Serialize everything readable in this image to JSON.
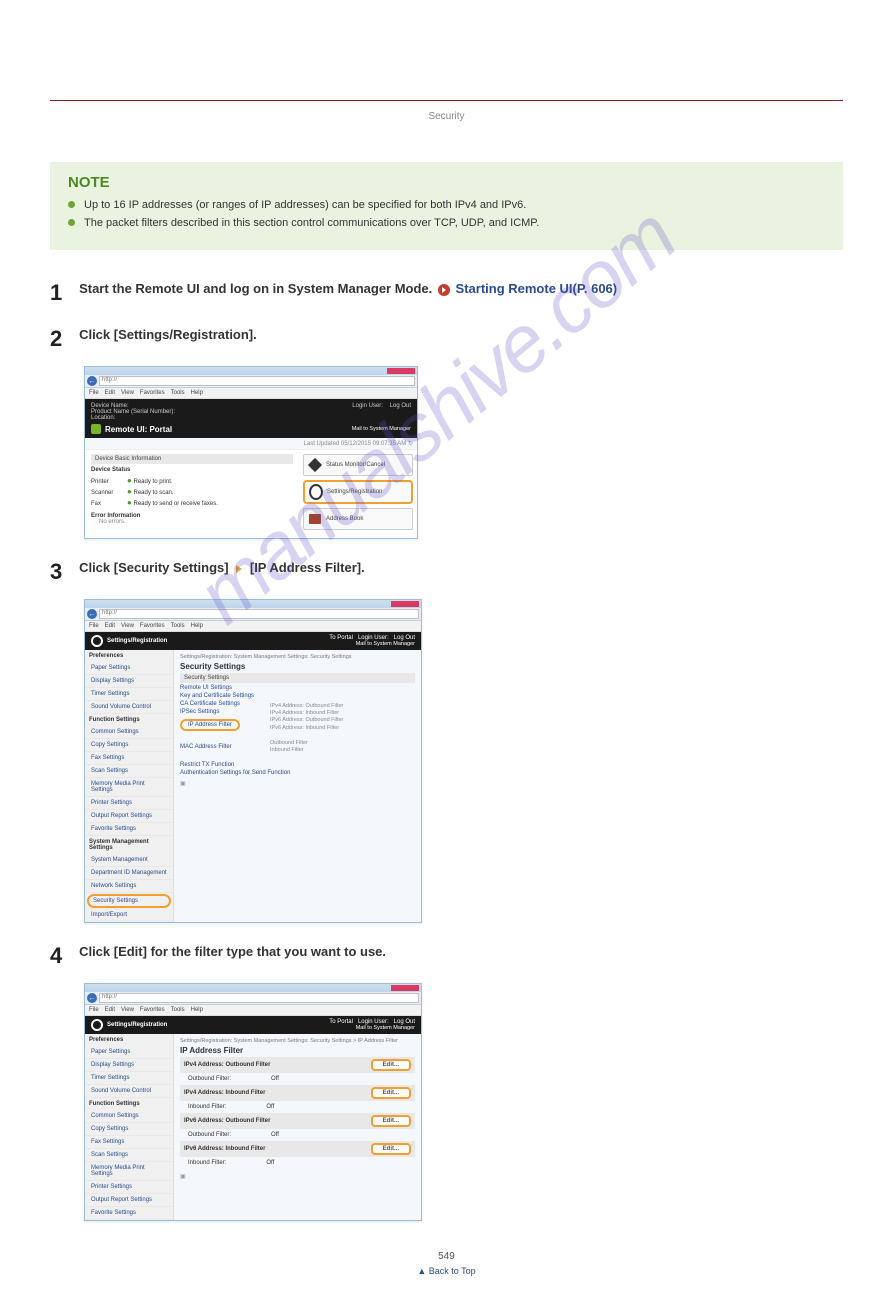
{
  "header": {
    "security_label": "Security"
  },
  "note": {
    "title": "NOTE",
    "items": [
      "Up to 16 IP addresses (or ranges of IP addresses) can be specified for both IPv4 and IPv6.",
      "The packet filters described in this section control communications over TCP, UDP, and ICMP."
    ]
  },
  "steps": {
    "s1": {
      "num": "1",
      "title_a": "Start the Remote UI and log on in System Manager Mode.",
      "link": "Starting Remote UI(P. 606)"
    },
    "s2": {
      "num": "2",
      "title": "Click [Settings/Registration]."
    },
    "s3": {
      "num": "3",
      "title_a": "Click [Security Settings]",
      "title_b": "[IP Address Filter]."
    },
    "s4": {
      "num": "4",
      "title": "Click [Edit] for the filter type that you want to use."
    }
  },
  "shot1": {
    "url": "http://",
    "menus": [
      "File",
      "Edit",
      "View",
      "Favorites",
      "Tools",
      "Help"
    ],
    "device_name": "Device Name:",
    "product": "Product Name (Serial Number):",
    "location": "Location:",
    "login": "Login User:",
    "logout": "Log Out",
    "portal_title": "Remote UI: Portal",
    "mail": "Mail to System Manager",
    "updated": "Last Updated 05/12/2015 09:07:35 AM",
    "dbi": "Device Basic Information",
    "ds": "Device Status",
    "printer_k": "Printer",
    "printer_v": "Ready to print.",
    "scanner_k": "Scanner",
    "scanner_v": "Ready to scan.",
    "fax_k": "Fax",
    "fax_v": "Ready to send or receive faxes.",
    "err": "Error Information",
    "noerr": "No errors.",
    "b1": "Status Monitor/Cancel",
    "b2": "Settings/Registration",
    "b3": "Address Book"
  },
  "shot2": {
    "url": "http://",
    "app": "Settings/Registration",
    "toportal": "To Portal",
    "loginuser": "Login User:",
    "logout": "Log Out",
    "mail": "Mail to System Manager",
    "crumb": "Settings/Registration: System Management Settings: Security Settings",
    "page_title": "Security Settings",
    "section_head": "Security Settings",
    "links": {
      "remote": "Remote UI Settings",
      "key": "Key and Certificate Settings",
      "ca": "CA Certificate Settings",
      "ipsec": "IPSec Settings",
      "ipfilter": "IP Address Filter",
      "mac": "MAC Address Filter",
      "restrict": "Restrict TX Function",
      "auth": "Authentication Settings for Send Function"
    },
    "sublist": [
      "IPv4 Address: Outbound Filter",
      "IPv4 Address: Inbound Filter",
      "IPv6 Address: Outbound Filter",
      "IPv6 Address: Inbound Filter",
      "Outbound Filter",
      "Inbound Filter"
    ],
    "sidebar": {
      "pref": "Preferences",
      "items_pref": [
        "Paper Settings",
        "Display Settings",
        "Timer Settings",
        "Sound Volume Control"
      ],
      "func": "Function Settings",
      "items_func": [
        "Common Settings",
        "Copy Settings",
        "Fax Settings",
        "Scan Settings",
        "Memory Media Print Settings",
        "Printer Settings",
        "Output Report Settings",
        "Favorite Settings"
      ],
      "sys": "System Management Settings",
      "items_sys": [
        "System Management",
        "Department ID Management",
        "Network Settings",
        "Security Settings",
        "Import/Export"
      ]
    }
  },
  "shot3": {
    "url": "http://",
    "app": "Settings/Registration",
    "crumb": "Settings/Registration: System Management Settings: Security Settings > IP Address Filter",
    "page_title": "IP Address Filter",
    "edit": "Edit...",
    "off": "Off",
    "sections": [
      {
        "head": "IPv4 Address: Outbound Filter",
        "label": "Outbound Filter:"
      },
      {
        "head": "IPv4 Address: Inbound Filter",
        "label": "Inbound Filter:"
      },
      {
        "head": "IPv6 Address: Outbound Filter",
        "label": "Outbound Filter:"
      },
      {
        "head": "IPv6 Address: Inbound Filter",
        "label": "Inbound Filter:"
      }
    ],
    "sidebar": {
      "pref": "Preferences",
      "items_pref": [
        "Paper Settings",
        "Display Settings",
        "Timer Settings",
        "Sound Volume Control"
      ],
      "func": "Function Settings",
      "items_func": [
        "Common Settings",
        "Copy Settings",
        "Fax Settings",
        "Scan Settings",
        "Memory Media Print Settings",
        "Printer Settings",
        "Output Report Settings",
        "Favorite Settings"
      ]
    }
  },
  "watermark": "manualshive.com",
  "page_num": "549",
  "back_top": "▲ Back to Top"
}
